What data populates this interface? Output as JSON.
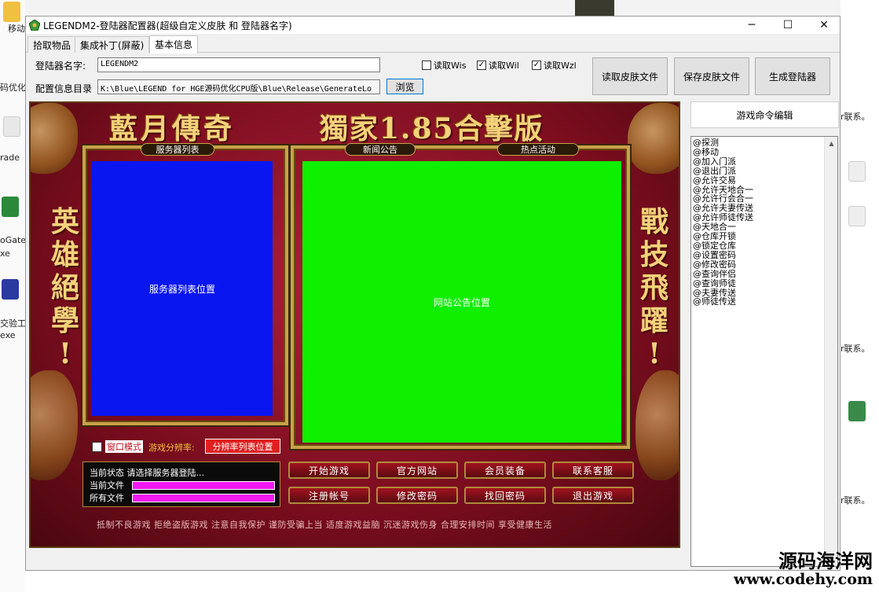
{
  "window": {
    "title": "LEGENDM2-登陆器配置器(超级自定义皮肤 和 登陆器名字)",
    "minimize": "─",
    "maximize": "☐",
    "close": "✕"
  },
  "tabs": [
    "拾取物品",
    "集成补丁(屏蔽)",
    "基本信息"
  ],
  "form": {
    "name_label": "登陆器名字:",
    "name_value": "LEGENDM2",
    "dir_label": "配置信息目录",
    "dir_value": "K:\\Blue\\LEGEND for HGE源码优化CPU版\\Blue\\Release\\GenerateLo",
    "browse": "浏览",
    "checks": [
      {
        "label": "读取Wis",
        "checked": false
      },
      {
        "label": "读取Wil",
        "checked": true
      },
      {
        "label": "读取Wzl",
        "checked": true
      }
    ],
    "buttons": [
      "读取皮肤文件",
      "保存皮肤文件",
      "生成登陆器"
    ]
  },
  "skin": {
    "title_left": "藍月傳奇",
    "title_right": "獨家1.85合擊版",
    "vert_left": [
      "英",
      "雄",
      "絕",
      "學",
      "!"
    ],
    "vert_right": [
      "戰",
      "技",
      "飛",
      "躍",
      "!"
    ],
    "plaque_server": "服务器列表",
    "plaque_news": "新闻公告",
    "plaque_hot": "热点活动",
    "server_area": "服务器列表位置",
    "notice_area": "网站公告位置",
    "window_mode": "窗口模式",
    "resolution_label": "游戏分辨率:",
    "resolution_box": "分辨率列表位置",
    "status_label": "当前状态",
    "status_value": "请选择服务器登陆...",
    "file_label": "当前文件",
    "all_label": "所有文件",
    "game_buttons": [
      "开始游戏",
      "官方网站",
      "会员装备",
      "联系客服",
      "注册帐号",
      "修改密码",
      "找回密码",
      "退出游戏"
    ],
    "footer": "抵制不良游戏 拒绝盗版游戏 注意自我保护 谨防受骗上当 适度游戏益脑 沉迷游戏伤身 合理安排时间 享受健康生活"
  },
  "commands": {
    "title": "游戏命令编辑",
    "items": [
      "@探测",
      "@移动",
      "@加入门派",
      "@退出门派",
      "@允许交易",
      "@允许天地合一",
      "@允许行会合一",
      "@允许夫妻传送",
      "@允许师徒传送",
      "@天地合一",
      "@仓库开锁",
      "@锁定仓库",
      "@设置密码",
      "@修改密码",
      "@查询伴侣",
      "@查询师徒",
      "@夫妻传送",
      "@师徒传送"
    ]
  },
  "desktop": {
    "left_texts": [
      "移动",
      "码优化",
      "rade",
      "oGate",
      "xe",
      "交验工",
      "exe"
    ],
    "right_texts": [
      "r联系。",
      "r联系。",
      "r联系。",
      "r联系。"
    ],
    "watermark_cn": "源码海洋网",
    "watermark_url": "www.codehy.com"
  },
  "colors": {
    "server_area": "#0a16f0",
    "notice_area": "#0ef000",
    "progress": "#f018f0"
  }
}
